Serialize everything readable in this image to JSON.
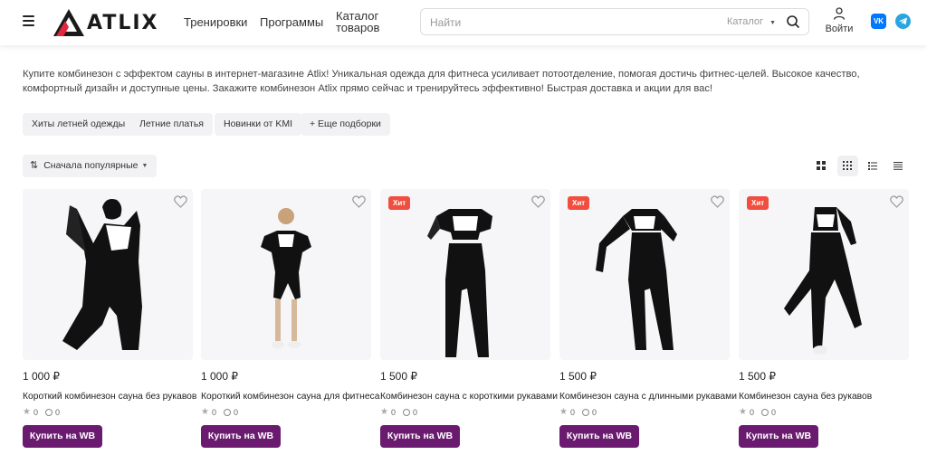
{
  "header": {
    "logo_text": "ATLIX",
    "nav": [
      "Тренировки",
      "Программы"
    ],
    "catalog_line1": "Каталог",
    "catalog_line2": "товаров",
    "search_placeholder": "Найти",
    "search_category": "Каталог",
    "login_label": "Войти",
    "vk_label": "VK"
  },
  "intro_text": "Купите комбинезон с эффектом сауны в интернет-магазине Atlix! Уникальная одежда для фитнеса усиливает потоотделение, помогая достичь фитнес-целей. Высокое качество, комфортный дизайн и доступные цены. Закажите комбинезон Atlix прямо сейчас и тренируйтесь эффективно! Быстрая доставка и акции для вас!",
  "chips": [
    "Хиты летней одежды",
    "Летние платья",
    "Новинки от KMI",
    "+ Еще подборки"
  ],
  "sort_label": "Сначала популярные",
  "colors": {
    "accent": "#6a1b6f",
    "badge": "#f04e3e"
  },
  "products": [
    {
      "price": "1 000 ₽",
      "title": "Короткий комбинезон сауна без рукавов",
      "rating": "0",
      "reviews": "0",
      "badge": "",
      "button": "Купить на WB"
    },
    {
      "price": "1 000 ₽",
      "title": "Короткий комбинезон сауна для фитнеса",
      "rating": "0",
      "reviews": "0",
      "badge": "",
      "button": "Купить на WB"
    },
    {
      "price": "1 500 ₽",
      "title": "Комбинезон сауна с короткими рукавами",
      "rating": "0",
      "reviews": "0",
      "badge": "Хит",
      "button": "Купить на WB"
    },
    {
      "price": "1 500 ₽",
      "title": "Комбинезон сауна с длинными рукавами",
      "rating": "0",
      "reviews": "0",
      "badge": "Хит",
      "button": "Купить на WB"
    },
    {
      "price": "1 500 ₽",
      "title": "Комбинезон сауна без рукавов",
      "rating": "0",
      "reviews": "0",
      "badge": "Хит",
      "button": "Купить на WB"
    }
  ]
}
